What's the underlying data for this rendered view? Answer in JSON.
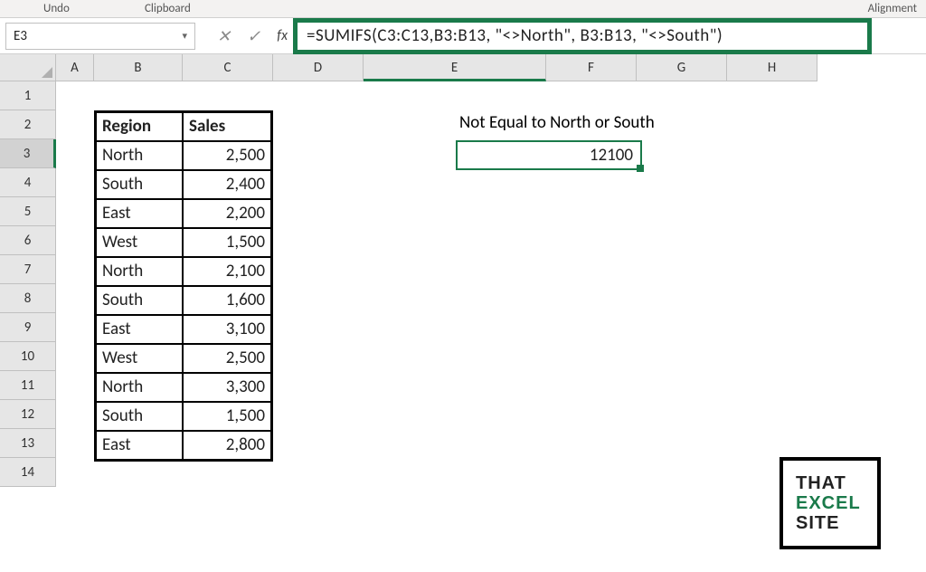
{
  "ribbon": {
    "undo": "Undo",
    "clipboard": "Clipboard",
    "alignment": "Alignment"
  },
  "cell_ref": "E3",
  "formula": "=SUMIFS(C3:C13,B3:B13, \"<>North\", B3:B13, \"<>South\")",
  "columns": {
    "A": "A",
    "B": "B",
    "C": "C",
    "D": "D",
    "E": "E",
    "F": "F",
    "G": "G",
    "H": "H"
  },
  "rows": [
    "1",
    "2",
    "3",
    "4",
    "5",
    "6",
    "7",
    "8",
    "9",
    "10",
    "11",
    "12",
    "13",
    "14"
  ],
  "table": {
    "h1": "Region",
    "h2": "Sales",
    "r": [
      {
        "reg": "North",
        "sal": "2,500"
      },
      {
        "reg": "South",
        "sal": "2,400"
      },
      {
        "reg": "East",
        "sal": "2,200"
      },
      {
        "reg": "West",
        "sal": "1,500"
      },
      {
        "reg": "North",
        "sal": "2,100"
      },
      {
        "reg": "South",
        "sal": "1,600"
      },
      {
        "reg": "East",
        "sal": "3,100"
      },
      {
        "reg": "West",
        "sal": "2,500"
      },
      {
        "reg": "North",
        "sal": "3,300"
      },
      {
        "reg": "South",
        "sal": "1,500"
      },
      {
        "reg": "East",
        "sal": "2,800"
      }
    ]
  },
  "result_label": "Not Equal to North or South",
  "result_value": "12100",
  "logo": {
    "l1": "THAT",
    "l2": "EXCEL",
    "l3": "SITE"
  }
}
